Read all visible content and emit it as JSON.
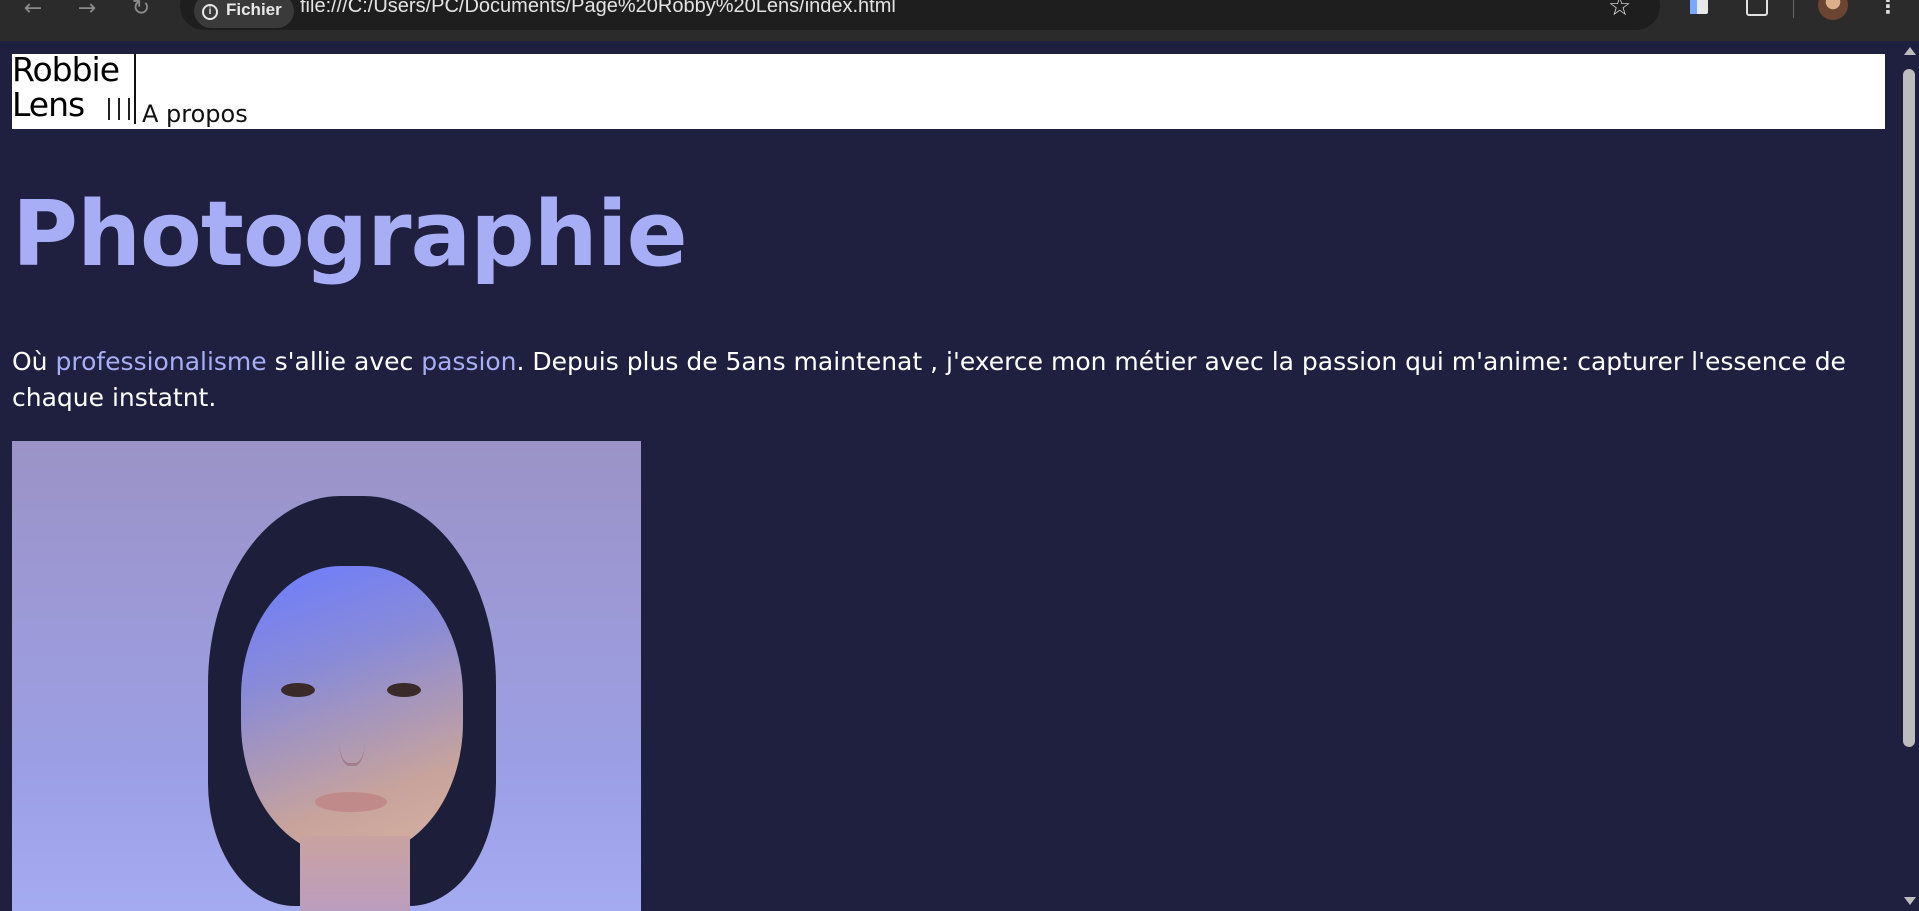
{
  "browser": {
    "back_icon": "←",
    "forward_icon": "→",
    "reload_icon": "↻",
    "site_label": "Fichier",
    "url": "file:///C:/Users/PC/Documents/Page%20Robby%20Lens/index.html",
    "star_icon": "☆",
    "menu_icon": "⋮"
  },
  "header": {
    "logo_line1": "Robbie",
    "logo_line2": "Lens",
    "nav_apropos": "A propos"
  },
  "main": {
    "title": "Photographie",
    "intro_prefix": "Où ",
    "intro_accent1": "professionalisme",
    "intro_mid": " s'allie avec ",
    "intro_accent2": "passion",
    "intro_suffix": ". Depuis plus de 5ans maintenat , j'exerce mon métier avec la passion qui m'anime: capturer l'essence de chaque instatnt."
  },
  "colors": {
    "page_bg": "#1f2040",
    "accent": "#a8aef5",
    "text": "#ffffff",
    "header_bg": "#ffffff"
  }
}
